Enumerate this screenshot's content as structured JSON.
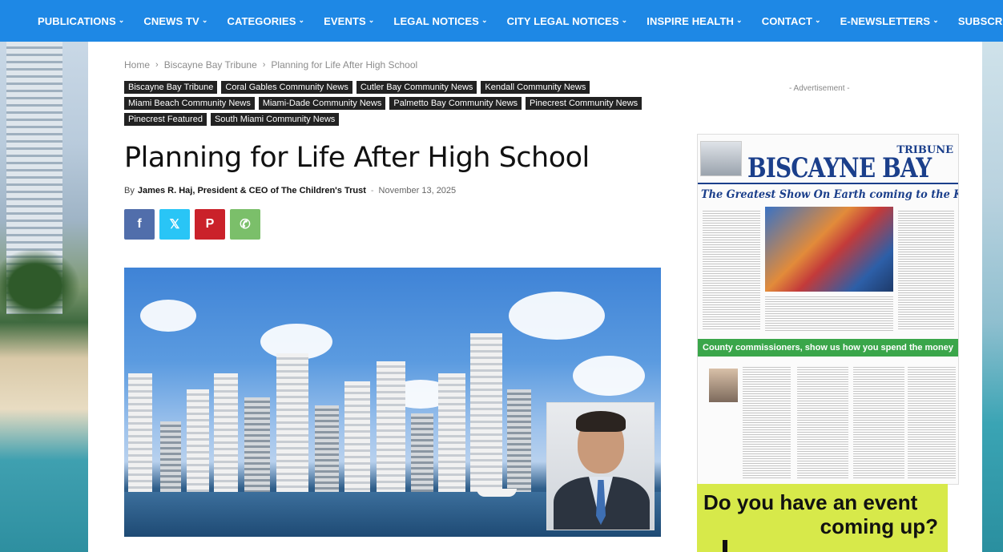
{
  "nav": {
    "items": [
      {
        "label": "PUBLICATIONS",
        "chevron": true
      },
      {
        "label": "CNEWS TV",
        "chevron": true
      },
      {
        "label": "CATEGORIES",
        "chevron": true
      },
      {
        "label": "EVENTS",
        "chevron": true
      },
      {
        "label": "LEGAL NOTICES",
        "chevron": true
      },
      {
        "label": "CITY LEGAL NOTICES",
        "chevron": true
      },
      {
        "label": "INSPIRE HEALTH",
        "chevron": true
      },
      {
        "label": "CONTACT",
        "chevron": true
      },
      {
        "label": "E-NEWSLETTERS",
        "chevron": true
      },
      {
        "label": "SUBSCRIBE",
        "chevron": false
      }
    ],
    "chevron_glyph": "⌄",
    "background": "#1e88e5"
  },
  "breadcrumb": {
    "items": [
      "Home",
      "Biscayne Bay Tribune",
      "Planning for Life After High School"
    ],
    "separator": "›"
  },
  "tags": {
    "rows": [
      [
        "Biscayne Bay Tribune",
        "Coral Gables Community News",
        "Cutler Bay Community News",
        "Kendall Community News"
      ],
      [
        "Miami Beach Community News",
        "Miami-Dade Community News",
        "Palmetto Bay Community News",
        "Pinecrest Community News"
      ],
      [
        "Pinecrest Featured",
        "South Miami Community News"
      ]
    ]
  },
  "article": {
    "title": "Planning for Life After High School",
    "by": "By",
    "author": "James R. Haj, President & CEO of The Children's Trust",
    "dash": "-",
    "date": "November 13, 2025"
  },
  "share": {
    "buttons": [
      {
        "name": "facebook-share-button",
        "icon": "facebook-icon",
        "glyph": "f",
        "cls": "share-fb"
      },
      {
        "name": "x-share-button",
        "icon": "x-icon",
        "glyph": "𝕏",
        "cls": "share-x"
      },
      {
        "name": "pinterest-share-button",
        "icon": "pinterest-icon",
        "glyph": "P",
        "cls": "share-pin"
      },
      {
        "name": "whatsapp-share-button",
        "icon": "whatsapp-icon",
        "glyph": "✆",
        "cls": "share-wa"
      }
    ]
  },
  "sidebar": {
    "ad_label": "- Advertisement -",
    "newspaper": {
      "brand": "BISCAYNE BAY",
      "tribune": "TRIBUNE",
      "headline": "The Greatest Show On Earth coming to the Kaseya Center",
      "green_bar": "County commissioners, show us how you spend the money"
    },
    "event_ad": {
      "line1": "Do you have an event",
      "line2": "coming up?"
    }
  }
}
